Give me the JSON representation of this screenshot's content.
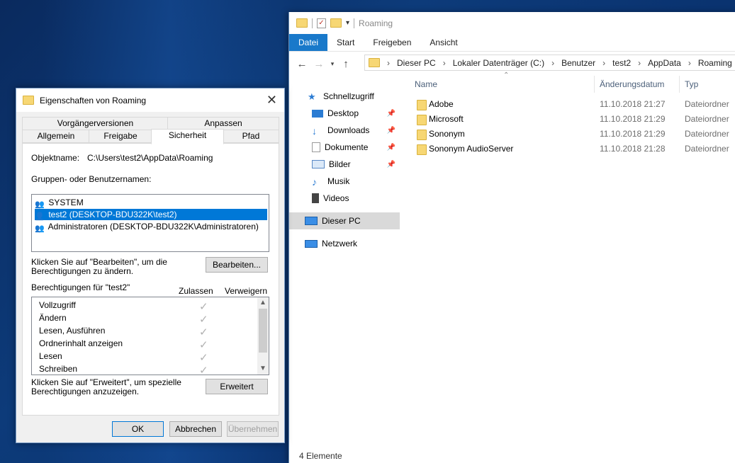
{
  "explorer": {
    "title": "Roaming",
    "ribbon_tabs": [
      "Datei",
      "Start",
      "Freigeben",
      "Ansicht"
    ],
    "breadcrumb": [
      "Dieser PC",
      "Lokaler Datenträger (C:)",
      "Benutzer",
      "test2",
      "AppData",
      "Roaming"
    ],
    "nav": {
      "quick_access": "Schnellzugriff",
      "items": [
        "Desktop",
        "Downloads",
        "Dokumente",
        "Bilder",
        "Musik",
        "Videos"
      ],
      "this_pc": "Dieser PC",
      "network": "Netzwerk"
    },
    "columns": {
      "name": "Name",
      "date": "Änderungsdatum",
      "type": "Typ"
    },
    "files": [
      {
        "name": "Adobe",
        "date": "11.10.2018 21:27",
        "type": "Dateiordner"
      },
      {
        "name": "Microsoft",
        "date": "11.10.2018 21:29",
        "type": "Dateiordner"
      },
      {
        "name": "Sononym",
        "date": "11.10.2018 21:29",
        "type": "Dateiordner"
      },
      {
        "name": "Sononym AudioServer",
        "date": "11.10.2018 21:28",
        "type": "Dateiordner"
      }
    ],
    "status": "4 Elemente"
  },
  "dialog": {
    "title": "Eigenschaften von Roaming",
    "tabs_top": [
      "Vorgängerversionen",
      "Anpassen"
    ],
    "tabs_bottom": [
      "Allgemein",
      "Freigabe",
      "Sicherheit",
      "Pfad"
    ],
    "object_label": "Objektname:",
    "object_value": "C:\\Users\\test2\\AppData\\Roaming",
    "groups_label": "Gruppen- oder Benutzernamen:",
    "users": [
      "SYSTEM",
      "test2 (DESKTOP-BDU322K\\test2)",
      "Administratoren (DESKTOP-BDU322K\\Administratoren)"
    ],
    "edit_hint_1": "Klicken Sie auf \"Bearbeiten\", um die",
    "edit_hint_2": "Berechtigungen zu ändern.",
    "edit_button": "Bearbeiten...",
    "perm_label": "Berechtigungen für \"test2\"",
    "allow": "Zulassen",
    "deny": "Verweigern",
    "permissions": [
      "Vollzugriff",
      "Ändern",
      "Lesen, Ausführen",
      "Ordnerinhalt anzeigen",
      "Lesen",
      "Schreiben"
    ],
    "adv_hint_1": "Klicken Sie auf \"Erweitert\", um spezielle",
    "adv_hint_2": "Berechtigungen anzuzeigen.",
    "advanced_button": "Erweitert",
    "ok": "OK",
    "cancel": "Abbrechen",
    "apply": "Übernehmen",
    "checkmark": "✓"
  }
}
